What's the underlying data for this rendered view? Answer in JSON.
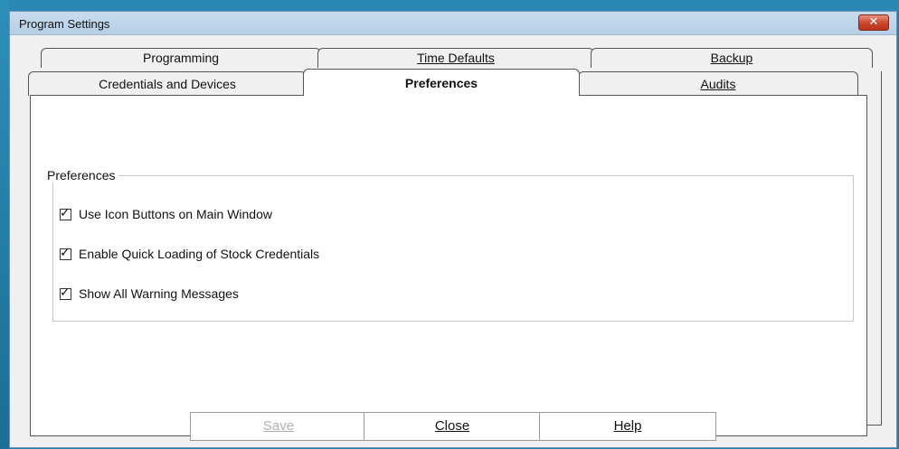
{
  "window": {
    "title": "Program Settings",
    "close_label": "✕"
  },
  "tabs": {
    "back_row": [
      {
        "label": "Programming",
        "underline_char": ""
      },
      {
        "label": "Time Defaults",
        "underline_char": "T"
      },
      {
        "label": "Backup",
        "underline_char": "B"
      }
    ],
    "front_row": [
      {
        "label": "Credentials and Devices",
        "underline_char": "D"
      },
      {
        "label": "Preferences",
        "active": true
      },
      {
        "label": "Audits",
        "underline_char": "A"
      }
    ]
  },
  "preferences": {
    "group_label": "Preferences",
    "options": [
      {
        "label": "Use Icon Buttons on Main Window",
        "checked": true
      },
      {
        "label": "Enable Quick Loading of Stock Credentials",
        "checked": true
      },
      {
        "label": "Show All Warning Messages",
        "checked": true
      }
    ]
  },
  "buttons": {
    "save": {
      "label": "Save",
      "enabled": false
    },
    "close": {
      "label": "Close",
      "enabled": true
    },
    "help": {
      "label": "Help",
      "enabled": true
    }
  },
  "check_glyph": "✓"
}
